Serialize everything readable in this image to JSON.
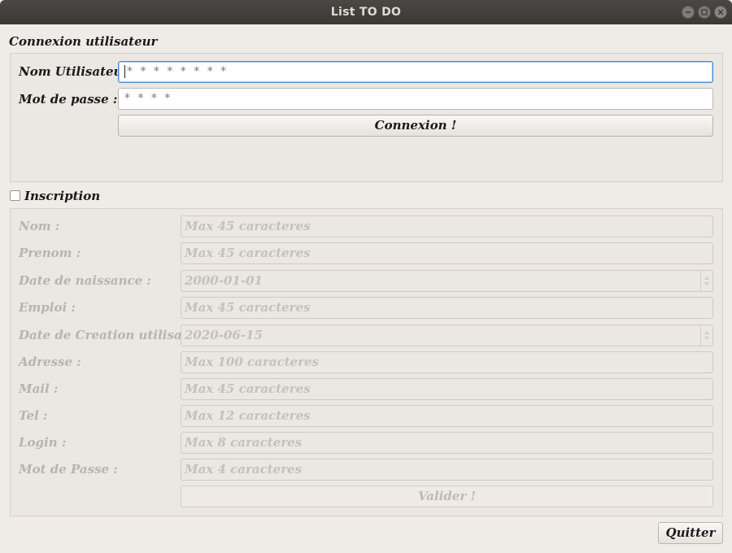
{
  "window": {
    "title": "List TO DO"
  },
  "login": {
    "title": "Connexion utilisateur",
    "username_label": "Nom Utilisateur :",
    "username_value": "* * * * * * * *",
    "password_label": "Mot de passe :",
    "password_value": "* * * *",
    "connect_button": "Connexion !"
  },
  "register": {
    "checkbox_label": "Inscription",
    "checked": false,
    "fields": [
      {
        "label": "Nom :",
        "placeholder": "Max 45 caracteres"
      },
      {
        "label": "Prenom :",
        "placeholder": "Max 45 caracteres"
      },
      {
        "label": "Date de naissance :",
        "value": "2000-01-01"
      },
      {
        "label": "Emploi :",
        "placeholder": "Max 45 caracteres"
      },
      {
        "label": "Date de Creation utilisateur :",
        "value": "2020-06-15"
      },
      {
        "label": "Adresse :",
        "placeholder": "Max 100 caracteres"
      },
      {
        "label": "Mail :",
        "placeholder": "Max 45 caracteres"
      },
      {
        "label": "Tel :",
        "placeholder": "Max 12 caracteres"
      },
      {
        "label": "Login :",
        "placeholder": "Max 8 caracteres"
      },
      {
        "label": "Mot de Passe :",
        "placeholder": "Max 4 caracteres"
      }
    ],
    "submit_button": "Valider !"
  },
  "quit_button": "Quitter",
  "colors": {
    "titlebar": "#3d3c39",
    "window_bg": "#efebe7",
    "focus": "#4b8fcf"
  }
}
